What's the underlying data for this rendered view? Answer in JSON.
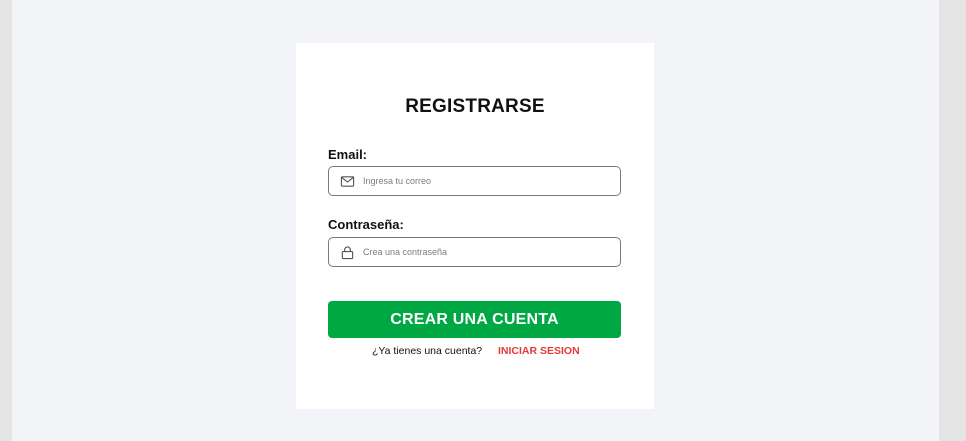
{
  "form": {
    "title": "REGISTRARSE",
    "email": {
      "label": "Email:",
      "placeholder": "Ingresa tu correo",
      "value": "",
      "icon": "mail-icon"
    },
    "password": {
      "label": "Contraseña:",
      "placeholder": "Crea una contraseña",
      "value": "",
      "icon": "lock-icon"
    },
    "submit_label": "CREAR UNA CUENTA",
    "footer_text": "¿Ya tienes una cuenta?",
    "login_link": "INICIAR SESION"
  },
  "colors": {
    "background_outer": "#e4e4e4",
    "background": "#f3f4f8",
    "card": "#ffffff",
    "primary_button": "#00a844",
    "link": "#e53935"
  }
}
